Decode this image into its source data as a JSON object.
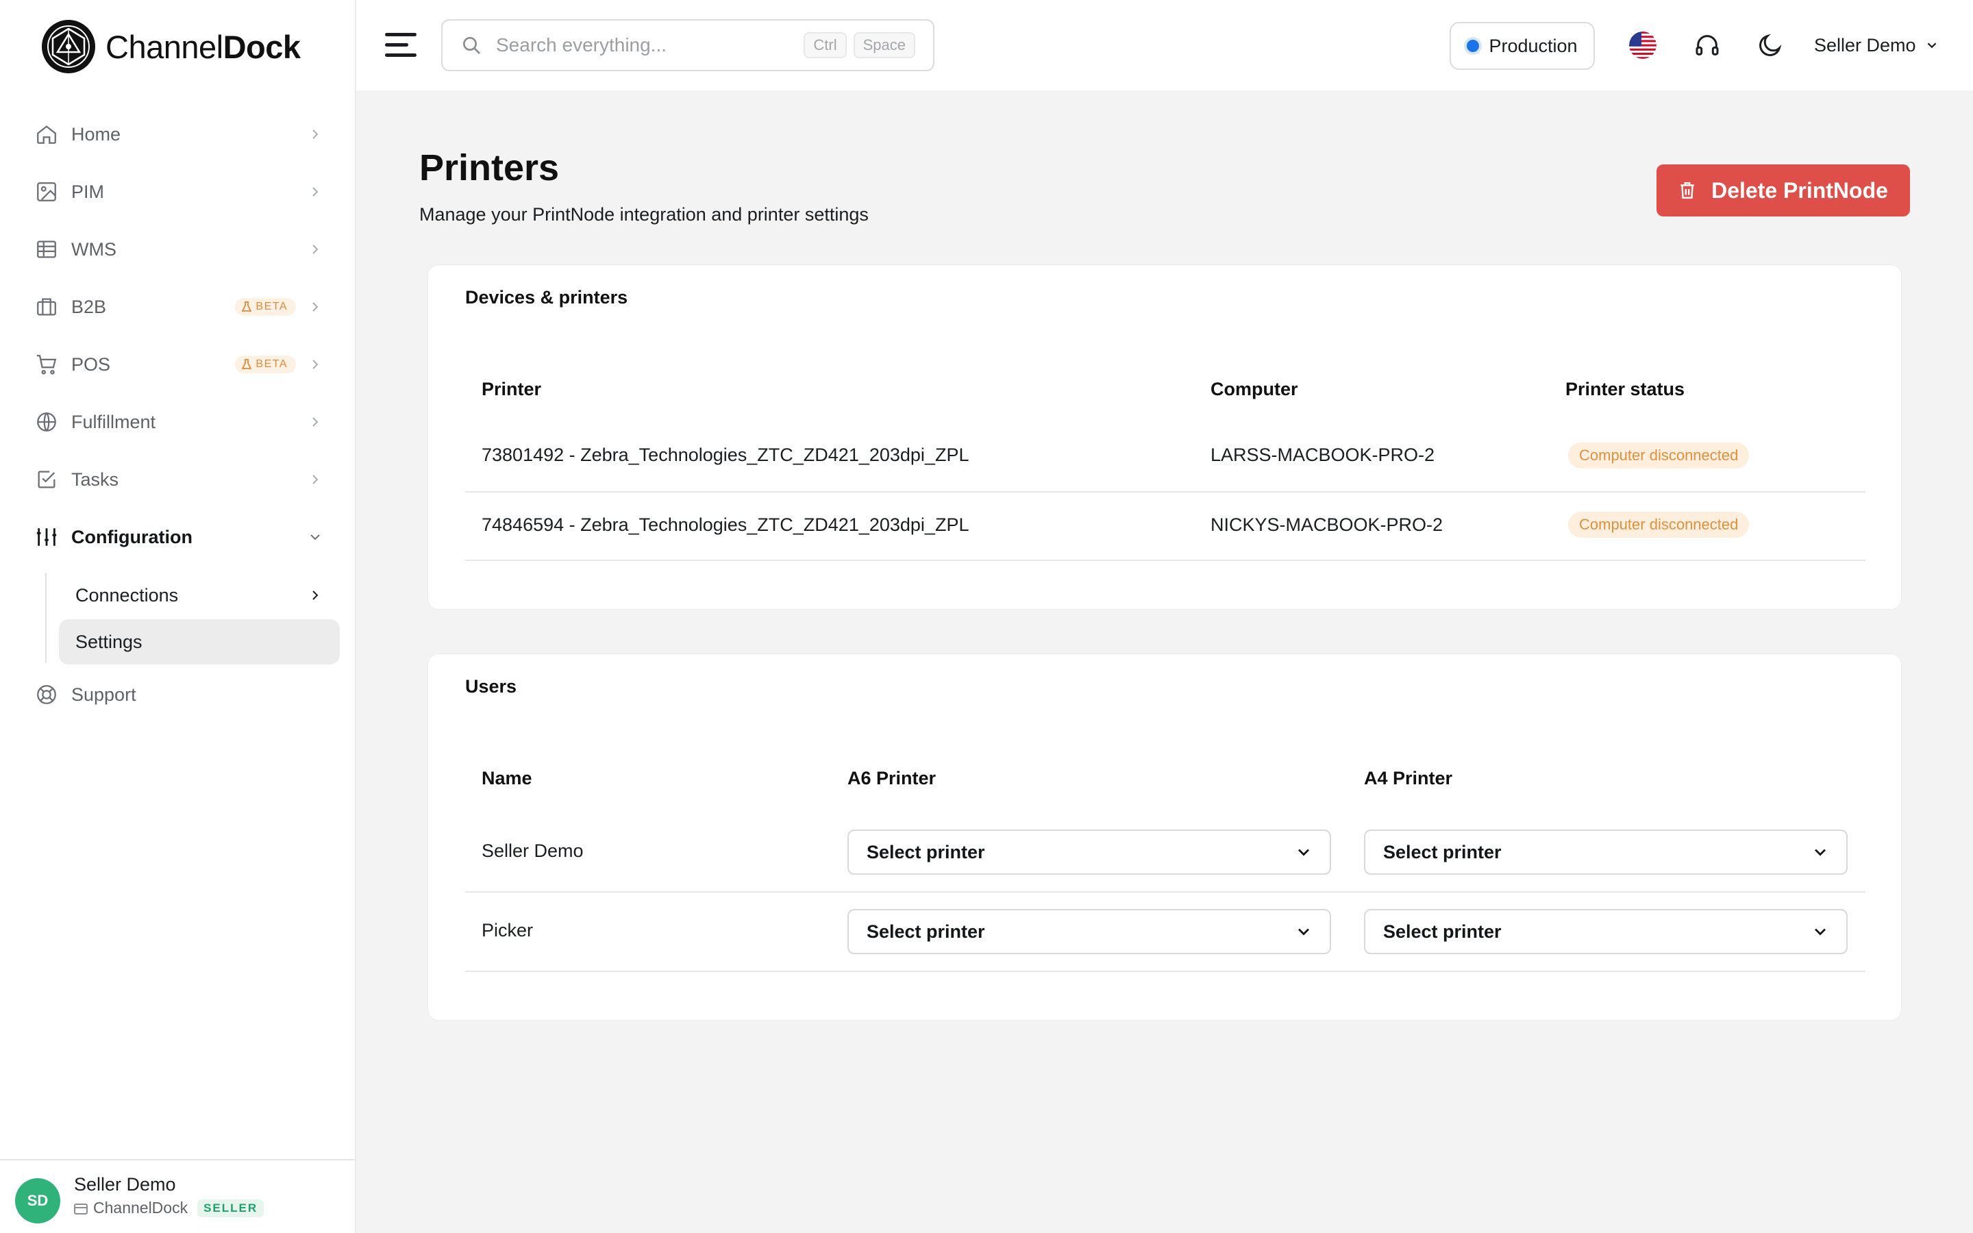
{
  "brand": {
    "name_regular": "Channel",
    "name_bold": "Dock"
  },
  "sidebar": {
    "items": [
      {
        "label": "Home",
        "icon": "home-icon"
      },
      {
        "label": "PIM",
        "icon": "image-icon"
      },
      {
        "label": "WMS",
        "icon": "table-icon"
      },
      {
        "label": "B2B",
        "icon": "briefcase-icon",
        "badge": "BETA"
      },
      {
        "label": "POS",
        "icon": "cart-icon",
        "badge": "BETA"
      },
      {
        "label": "Fulfillment",
        "icon": "globe-icon"
      },
      {
        "label": "Tasks",
        "icon": "checkbox-icon"
      },
      {
        "label": "Configuration",
        "icon": "sliders-icon"
      }
    ],
    "subitems": [
      {
        "label": "Connections"
      },
      {
        "label": "Settings"
      }
    ],
    "support": {
      "label": "Support",
      "icon": "lifebuoy-icon"
    }
  },
  "user": {
    "initials": "SD",
    "name": "Seller Demo",
    "company": "ChannelDock",
    "role": "SELLER"
  },
  "topbar": {
    "search_placeholder": "Search everything...",
    "shortcut_1": "Ctrl",
    "shortcut_2": "Space",
    "environment": "Production",
    "account": "Seller Demo"
  },
  "page": {
    "title": "Printers",
    "subtitle": "Manage your PrintNode integration and printer settings",
    "delete_button": "Delete PrintNode"
  },
  "devices": {
    "title": "Devices & printers",
    "columns": [
      "Printer",
      "Computer",
      "Printer status"
    ],
    "rows": [
      {
        "printer": "73801492 - Zebra_Technologies_ZTC_ZD421_203dpi_ZPL",
        "computer": "LARSS-MACBOOK-PRO-2",
        "status": "Computer disconnected"
      },
      {
        "printer": "74846594 - Zebra_Technologies_ZTC_ZD421_203dpi_ZPL",
        "computer": "NICKYS-MACBOOK-PRO-2",
        "status": "Computer disconnected"
      }
    ]
  },
  "users": {
    "title": "Users",
    "columns": [
      "Name",
      "A6 Printer",
      "A4 Printer"
    ],
    "rows": [
      {
        "name": "Seller Demo",
        "a6": "Select printer",
        "a4": "Select printer"
      },
      {
        "name": "Picker",
        "a6": "Select printer",
        "a4": "Select printer"
      }
    ]
  },
  "colors": {
    "accent": "#1a73e8",
    "danger": "#de4f4a",
    "warning_text": "#e0913e",
    "success": "#2fb37a"
  }
}
